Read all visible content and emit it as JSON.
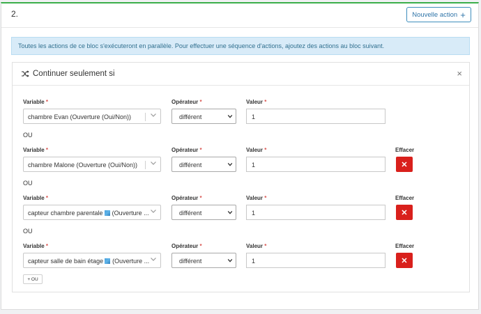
{
  "block": {
    "number": "2.",
    "new_action_label": "Nouvelle action",
    "new_action_plus": "+"
  },
  "info": {
    "text": "Toutes les actions de ce bloc s'exécuteront en parallèle. Pour effectuer une séquence d'actions, ajoutez des actions au bloc suivant."
  },
  "condition": {
    "title": "Continuer seulement si",
    "close_glyph": "×",
    "labels": {
      "variable": "Variable",
      "operator": "Opérateur",
      "value": "Valeur",
      "delete": "Effacer",
      "required": "*"
    },
    "or_text": "OU",
    "add_or_label": "+ OU",
    "delete_glyph": "✕",
    "rows": [
      {
        "variable": "chambre Evan (Ouverture (Oui/Non))",
        "variable_suffix": "",
        "operator": "différent",
        "value": "1"
      },
      {
        "variable": "chambre Malone (Ouverture (Oui/Non))",
        "variable_suffix": "",
        "operator": "différent",
        "value": "1"
      },
      {
        "variable": "capteur chambre parentale",
        "variable_suffix": "(Ouverture ...",
        "operator": "différent",
        "value": "1"
      },
      {
        "variable": "capteur salle de bain étage",
        "variable_suffix": "(Ouverture ...",
        "operator": "différent",
        "value": "1"
      }
    ]
  },
  "colors": {
    "accent_green": "#3aae4a",
    "primary_blue": "#3c8dbc",
    "danger_red": "#d9201c",
    "info_bg": "#d8ebf8"
  }
}
